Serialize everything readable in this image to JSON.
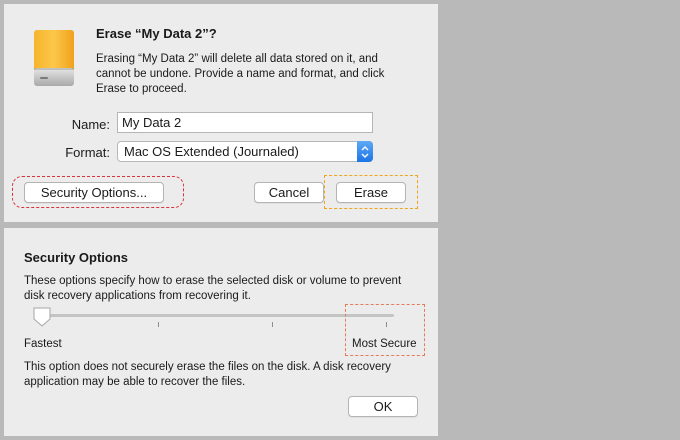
{
  "erase_dialog": {
    "title": "Erase “My Data 2”?",
    "description": "Erasing “My Data 2” will delete all data stored on it, and cannot be undone. Provide a name and format, and click Erase to proceed.",
    "name_label": "Name:",
    "name_value": "My Data 2",
    "format_label": "Format:",
    "format_value": "Mac OS Extended (Journaled)",
    "security_options_button": "Security Options...",
    "cancel_button": "Cancel",
    "erase_button": "Erase",
    "icon": "external-drive-icon"
  },
  "security_options": {
    "title": "Security Options",
    "description": "These options specify how to erase the selected disk or volume to prevent disk recovery applications from recovering it.",
    "slider_level": 0,
    "slider_steps": 4,
    "min_label": "Fastest",
    "max_label": "Most Secure",
    "note": "This option does not securely erase the files on the disk. A disk recovery application may be able to recover the files.",
    "ok_button": "OK"
  },
  "colors": {
    "highlight_red": "#d8333a",
    "highlight_orange": "#f2a31c",
    "accent_blue": "#1c74e6",
    "disk_orange": "#f5a623"
  }
}
